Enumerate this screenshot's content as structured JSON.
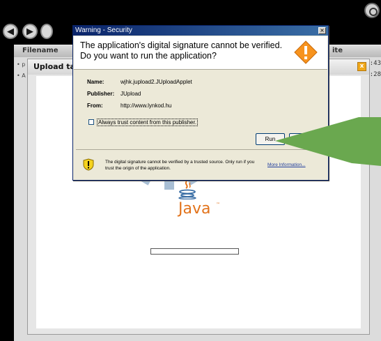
{
  "background": {
    "file_header": {
      "filename_col": "Filename",
      "date_col": "ite"
    },
    "file_rows": [
      {
        "marker": "• p",
        "time": ":41:43"
      },
      {
        "marker": "• A",
        "time": ":36:28"
      }
    ],
    "upload_dialog": {
      "title": "Upload targ",
      "close_glyph": "x"
    },
    "java": {
      "text": "Java",
      "tm": "™"
    }
  },
  "security_dialog": {
    "title": "Warning - Security",
    "close_glyph": "×",
    "headline_line1": "The application's digital signature cannot be verified.",
    "headline_line2": "Do you want to run the application?",
    "details": [
      {
        "key": "Name:",
        "value": "wjhk.jupload2.JUploadApplet"
      },
      {
        "key": "Publisher:",
        "value": "JUpload"
      },
      {
        "key": "From:",
        "value": "http://www.lynkod.hu"
      }
    ],
    "always_trust_label": "Always trust content from this publisher.",
    "always_trust_checked": false,
    "run_label": "Run",
    "footnote": "The digital signature cannot be verified by a trusted source.  Only run if you trust the origin of the application.",
    "more_info_label": "More Information..."
  },
  "colors": {
    "title_bar": "#0a246a",
    "dialog_bg": "#ece9d8",
    "warning_orange": "#f7931e",
    "java_orange": "#e2731b",
    "arrow_green": "#6aa84f"
  }
}
